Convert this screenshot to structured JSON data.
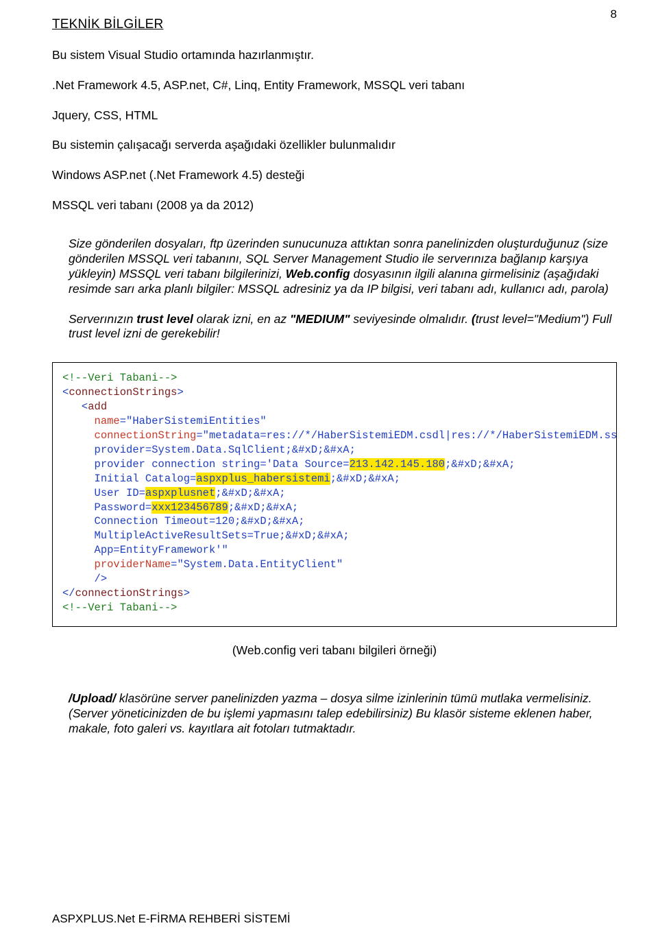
{
  "page_number": "8",
  "title": "TEKNİK BİLGİLER ",
  "intro1": "Bu sistem Visual Studio ortamında hazırlanmıştır.",
  "intro2": ".Net Framework 4.5, ASP.net, C#, Linq, Entity Framework, MSSQL veri tabanı",
  "intro3": "Jquery, CSS, HTML",
  "req_title": "Bu sistemin çalışacağı serverda aşağıdaki özellikler bulunmalıdır",
  "req1": "Windows ASP.net (.Net Framework 4.5) desteği",
  "req2": "MSSQL veri tabanı (2008 ya da 2012)",
  "para_a": "Size gönderilen dosyaları, ftp üzerinden sunucunuza attıktan sonra panelinizden oluşturduğunuz (size gönderilen MSSQL veri tabanını, SQL Server Management Studio ile serverınıza bağlanıp karşıya yükleyin) MSSQL veri tabanı bilgilerinizi, ",
  "para_a_bi": "Web.config",
  "para_a_rest": " dosyasının ilgili alanına girmelisiniz (aşağıdaki resimde sarı arka planlı bilgiler: MSSQL adresiniz ya da IP bilgisi, veri tabanı adı, kullanıcı adı, parola)",
  "para_b_pre": "Serverınızın ",
  "para_b_trust": "trust level",
  "para_b_mid": " olarak izni, en az ",
  "para_b_medium": "\"MEDIUM\"",
  "para_b_post": " seviyesinde olmalıdır. ",
  "para_b_paren_open": "(",
  "para_b_paren_body": "trust level=\"Medium\") Full trust level izni de gerekebilir!",
  "code": {
    "c1": "<!--Veri Tabani-->",
    "c2_open": "<",
    "c2_tag": "connectionStrings",
    "c2_close": ">",
    "c3_open": "<",
    "c3_tag": "add",
    "nameAttr": "name",
    "nameVal": "=\"HaberSistemiEntities\"",
    "connAttr": "connectionString",
    "connEq": "=\"metadata=res://*/HaberSistemiEDM.csdl|res://*/HaberSistemiEDM.ssdl|",
    "provLine": "provider=System.Data.SqlClient;&#xD;&#xA;",
    "provStr1": "provider connection string='Data Source=",
    "ip": "213.142.145.180",
    "provStr2": ";&#xD;&#xA;",
    "initCat1": "Initial Catalog=",
    "dbname": "aspxplus_habersistemi",
    "initCat2": ";&#xD;&#xA;",
    "userId1": "User ID=",
    "username": "aspxplusnet",
    "userId2": ";&#xD;&#xA;",
    "pass1": "Password=",
    "password": "xxx123456789",
    "pass2": ";&#xD;&#xA;",
    "timeout": "Connection Timeout=120;&#xD;&#xA;",
    "mars": "MultipleActiveResultSets=True;&#xD;&#xA;",
    "app": "App=EntityFramework'\"",
    "provNameAttr": "providerName",
    "provNameVal": "=\"System.Data.EntityClient\"",
    "selfClose": "/>",
    "endOpen": "</",
    "endTag": "connectionStrings",
    "endClose": ">",
    "c_end": "<!--Veri Tabani-->"
  },
  "caption": "(Web.config veri tabanı bilgileri örneği)",
  "upload_bi": "/Upload/",
  "upload_rest": " klasörüne server panelinizden yazma – dosya silme izinlerinin tümü mutlaka vermelisiniz. (Server yöneticinizden de bu işlemi yapmasını talep edebilirsiniz) Bu klasör sisteme eklenen haber, makale, foto galeri vs. kayıtlara ait fotoları tutmaktadır.",
  "footer": "ASPXPLUS.Net E-FİRMA REHBERİ SİSTEMİ"
}
